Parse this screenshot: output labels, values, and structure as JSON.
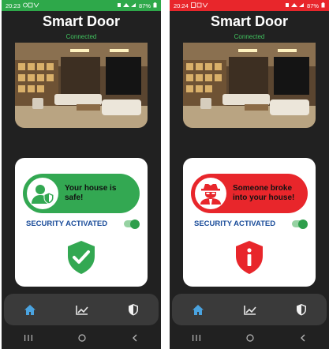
{
  "screens": [
    {
      "status": {
        "time": "20:23",
        "battery": "87%"
      },
      "app_title": "Smart Door",
      "connection_status": "Connected",
      "alert_message_line1": "Your house is",
      "alert_message_line2": "safe!",
      "security_label": "SECURITY ACTIVATED",
      "state": "safe",
      "accent_color": "#33a852",
      "status_icon": "check-shield-icon",
      "security_toggle_on": true
    },
    {
      "status": {
        "time": "20:24",
        "battery": "87%"
      },
      "app_title": "Smart Door",
      "connection_status": "Connected",
      "alert_message_line1": "Someone broke",
      "alert_message_line2": "into your house!",
      "security_label": "SECURITY ACTIVATED",
      "state": "intruder",
      "accent_color": "#e8262b",
      "status_icon": "alert-shield-icon",
      "security_toggle_on": true
    }
  ],
  "bottom_nav": {
    "items": [
      "home-icon",
      "chart-icon",
      "shield-icon"
    ],
    "active": "home-icon",
    "active_color": "#4aa3df"
  },
  "system_nav": [
    "recents-icon",
    "home-circle-icon",
    "back-icon"
  ]
}
